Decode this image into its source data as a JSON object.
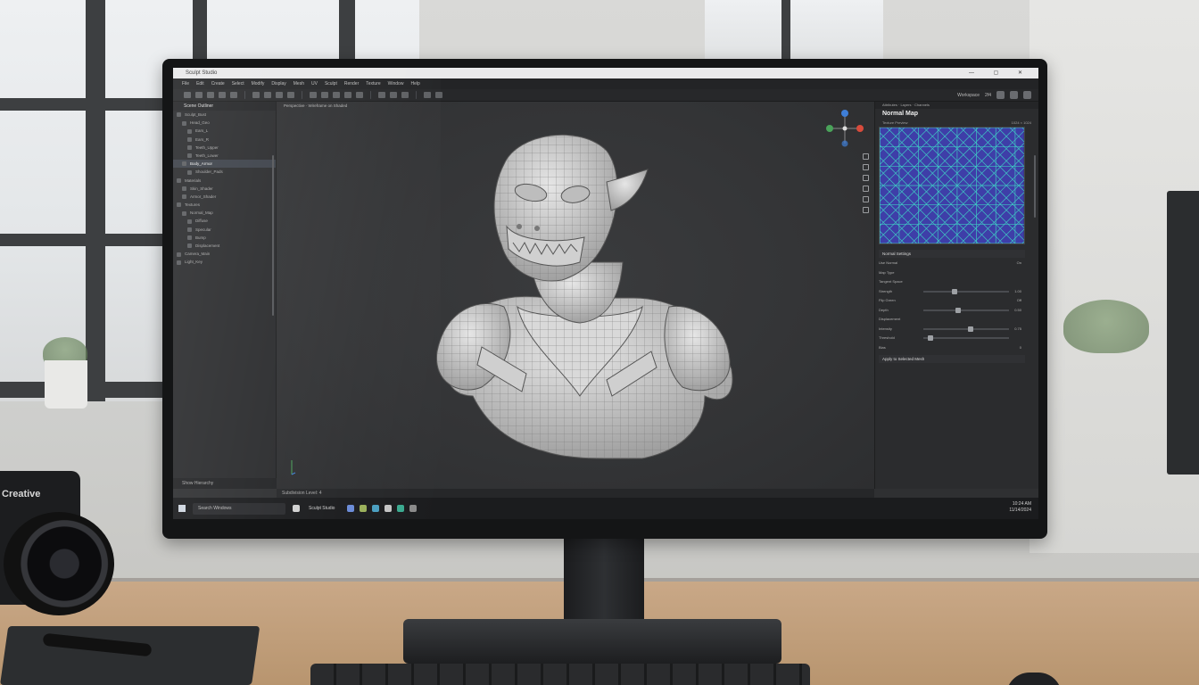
{
  "window": {
    "title": "Sculpt Studio",
    "controls": "— ▢ ✕"
  },
  "menu": [
    "File",
    "Edit",
    "Create",
    "Select",
    "Modify",
    "Display",
    "Mesh",
    "UV",
    "Sculpt",
    "Render",
    "Texture",
    "Window",
    "Help"
  ],
  "toolbar_right": {
    "label": "Workspace",
    "zoom": "2f4"
  },
  "outliner": {
    "title": "Scene Outliner",
    "items": [
      {
        "label": "Sculpt_Bust",
        "selected": false
      },
      {
        "label": "Head_Geo",
        "selected": false
      },
      {
        "label": "Ears_L",
        "selected": false
      },
      {
        "label": "Ears_R",
        "selected": false
      },
      {
        "label": "Teeth_Upper",
        "selected": false
      },
      {
        "label": "Teeth_Lower",
        "selected": false
      },
      {
        "label": "Body_Armor",
        "selected": true
      },
      {
        "label": "Shoulder_Pads",
        "selected": false
      },
      {
        "label": "Materials",
        "selected": false
      },
      {
        "label": "Skin_Shader",
        "selected": false
      },
      {
        "label": "Armor_Shader",
        "selected": false
      },
      {
        "label": "Textures",
        "selected": false
      },
      {
        "label": "Normal_Map",
        "selected": false
      },
      {
        "label": "Diffuse",
        "selected": false
      },
      {
        "label": "Specular",
        "selected": false
      },
      {
        "label": "Bump",
        "selected": false
      },
      {
        "label": "Displacement",
        "selected": false
      },
      {
        "label": "Camera_Main",
        "selected": false
      },
      {
        "label": "Light_Key",
        "selected": false
      }
    ],
    "footer": "Show Hierarchy"
  },
  "viewport": {
    "header": "Perspective · Wireframe on Shaded",
    "status": "Subdivision Level: 4"
  },
  "properties": {
    "tabs": "Attributes · Layers · Channels",
    "title": "Normal Map",
    "subtitle": "Texture Preview",
    "subtitle_right": "1024 × 1024",
    "section": "Normal Settings",
    "rows": [
      {
        "label": "Use Normal",
        "value": "On",
        "knob": null
      },
      {
        "label": "Map Type",
        "value": "",
        "knob": null
      },
      {
        "label": "Tangent Space",
        "value": "",
        "knob": null
      },
      {
        "label": "Strength",
        "value": "1.00",
        "knob": 0.35
      },
      {
        "label": "Flip Green",
        "value": "Off",
        "knob": null
      },
      {
        "label": "Depth",
        "value": "0.50",
        "knob": 0.4
      },
      {
        "label": "Displacement",
        "value": "",
        "knob": null
      },
      {
        "label": "Intensity",
        "value": "0.75",
        "knob": 0.55
      },
      {
        "label": "Threshold",
        "value": "",
        "knob": 0.05
      },
      {
        "label": "Bias",
        "value": "0",
        "knob": null
      }
    ],
    "footer": "Apply to Selected Mesh"
  },
  "taskbar": {
    "search": "Search Windows",
    "app_label": "Sculpt Studio",
    "tray_time": "10:24 AM",
    "tray_date": "11/14/2024"
  },
  "camera_brand": "Creative",
  "colors": {
    "accent_selection": "#3b4048",
    "gizmo_x": "#d84b3c",
    "gizmo_y": "#4aa35a",
    "gizmo_z": "#3f7fd8",
    "map_base": "#3e3ea8",
    "map_lines": "#3fe0c8"
  }
}
